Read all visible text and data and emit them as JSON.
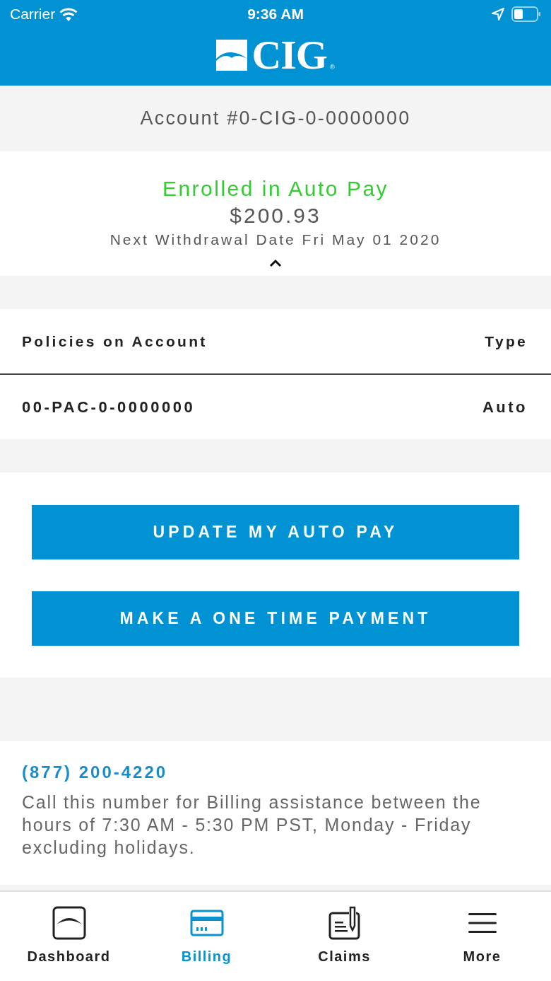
{
  "status_bar": {
    "carrier": "Carrier",
    "time": "9:36 AM"
  },
  "header": {
    "logo": {
      "text": "CIG",
      "mark": "®"
    }
  },
  "account": {
    "label": "Account #0-CIG-0-0000000"
  },
  "auto_pay": {
    "status": "Enrolled in Auto Pay",
    "amount": "$200.93",
    "next_withdrawal": "Next Withdrawal Date Fri May 01 2020",
    "expanded": true
  },
  "policies": {
    "columns": [
      "Policies on Account",
      "Type"
    ],
    "rows": [
      [
        "00-PAC-0-0000000",
        "Auto"
      ]
    ]
  },
  "buttons": [
    "UPDATE MY AUTO PAY",
    "MAKE A ONE TIME PAYMENT"
  ],
  "contact": {
    "phone": "(877) 200-4220",
    "note": "Call this number for Billing assistance between the hours of 7:30 AM - 5:30 PM PST, Monday - Friday excluding holidays."
  },
  "tabs": [
    {
      "label": "Dashboard",
      "selected": false
    },
    {
      "label": "Billing",
      "selected": true
    },
    {
      "label": "Claims",
      "selected": false
    },
    {
      "label": "More",
      "selected": false
    }
  ]
}
